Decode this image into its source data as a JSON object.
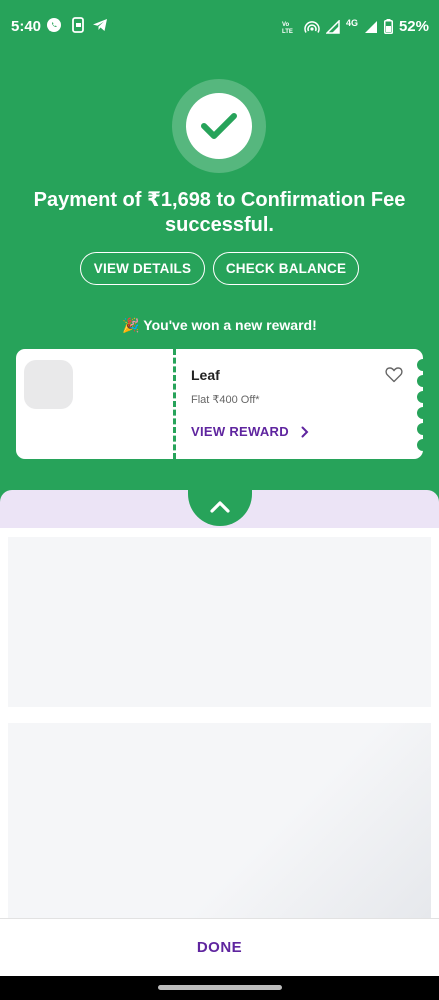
{
  "status_bar": {
    "time": "5:40",
    "network": "4G",
    "battery": "52%",
    "volte": "VoLTE"
  },
  "result": {
    "title": "Payment of ₹1,698 to Confirmation Fee successful.",
    "buttons": {
      "view_details": "VIEW DETAILS",
      "check_balance": "CHECK BALANCE"
    }
  },
  "reward": {
    "message": "🎉 You've won a new reward!",
    "brand": "Leaf",
    "offer": "Flat ₹400 Off*",
    "cta": "VIEW REWARD"
  },
  "footer": {
    "done_label": "DONE"
  },
  "colors": {
    "primary_green": "#27a35a",
    "accent_purple": "#5f259f",
    "lavender": "#ece4f6"
  }
}
